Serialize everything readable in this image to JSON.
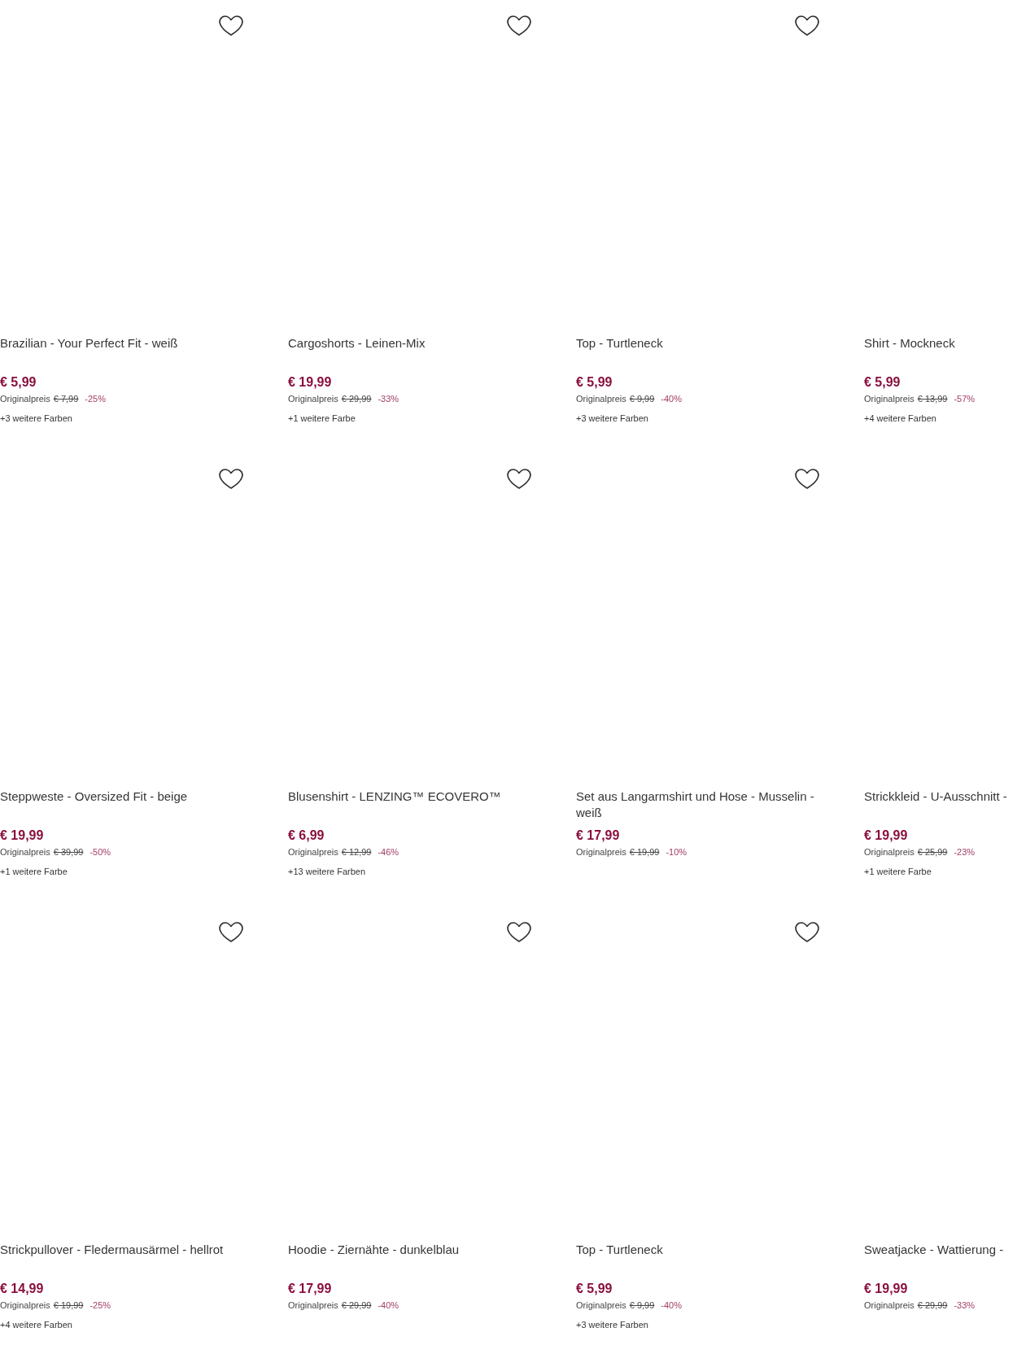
{
  "products": [
    {
      "title": "Brazilian - Your Perfect Fit - weiß",
      "price": "€ 5,99",
      "original_label": "Originalpreis",
      "original_price": "€ 7,99",
      "discount": "-25%",
      "colors": "+3 weitere Farben"
    },
    {
      "title": "Cargoshorts - Leinen-Mix",
      "price": "€ 19,99",
      "original_label": "Originalpreis",
      "original_price": "€ 29,99",
      "discount": "-33%",
      "colors": "+1 weitere Farbe"
    },
    {
      "title": "Top - Turtleneck",
      "price": "€ 5,99",
      "original_label": "Originalpreis",
      "original_price": "€ 9,99",
      "discount": "-40%",
      "colors": "+3 weitere Farben"
    },
    {
      "title": "Shirt - Mockneck",
      "price": "€ 5,99",
      "original_label": "Originalpreis",
      "original_price": "€ 13,99",
      "discount": "-57%",
      "colors": "+4 weitere Farben"
    },
    {
      "title": "Steppweste - Oversized Fit - beige",
      "price": "€ 19,99",
      "original_label": "Originalpreis",
      "original_price": "€ 39,99",
      "discount": "-50%",
      "colors": "+1 weitere Farbe"
    },
    {
      "title": "Blusenshirt - LENZING™ ECOVERO™",
      "price": "€ 6,99",
      "original_label": "Originalpreis",
      "original_price": "€ 12,99",
      "discount": "-46%",
      "colors": "+13 weitere Farben"
    },
    {
      "title": "Set aus Langarmshirt und Hose - Musselin - weiß",
      "price": "€ 17,99",
      "original_label": "Originalpreis",
      "original_price": "€ 19,99",
      "discount": "-10%"
    },
    {
      "title": "Strickkleid - U-Ausschnitt -",
      "price": "€ 19,99",
      "original_label": "Originalpreis",
      "original_price": "€ 25,99",
      "discount": "-23%",
      "colors": "+1 weitere Farbe"
    },
    {
      "title": "Strickpullover - Fledermausärmel - hellrot",
      "price": "€ 14,99",
      "original_label": "Originalpreis",
      "original_price": "€ 19,99",
      "discount": "-25%",
      "colors": "+4 weitere Farben"
    },
    {
      "title": "Hoodie - Ziernähte - dunkelblau",
      "price": "€ 17,99",
      "original_label": "Originalpreis",
      "original_price": "€ 29,99",
      "discount": "-40%"
    },
    {
      "title": "Top - Turtleneck",
      "price": "€ 5,99",
      "original_label": "Originalpreis",
      "original_price": "€ 9,99",
      "discount": "-40%",
      "colors": "+3 weitere Farben"
    },
    {
      "title": "Sweatjacke - Wattierung -",
      "price": "€ 19,99",
      "original_label": "Originalpreis",
      "original_price": "€ 29,99",
      "discount": "-33%"
    }
  ]
}
